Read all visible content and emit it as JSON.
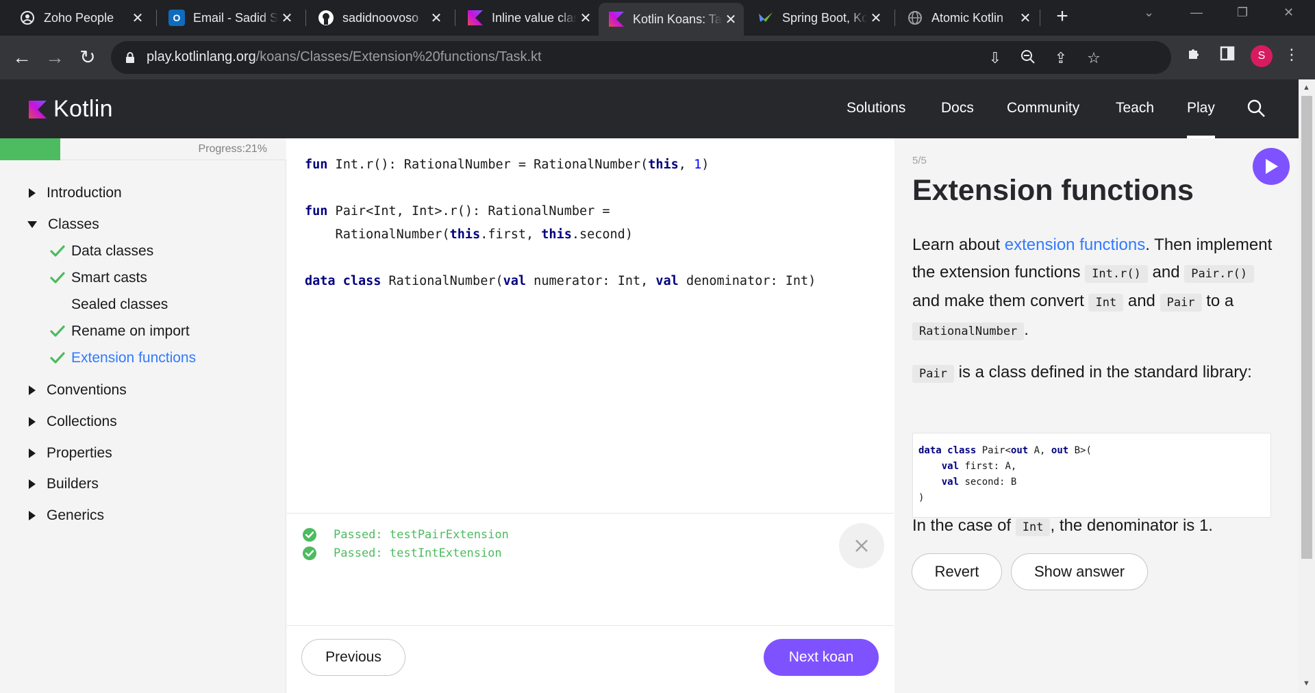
{
  "browser": {
    "tabs": [
      {
        "title": "Zoho People",
        "favicon_color": "#e8eaed"
      },
      {
        "title": "Email - Sadid Sahami",
        "favicon_color": "#0f6cbd"
      },
      {
        "title": "sadidnoovoso",
        "favicon_color": "#ffffff"
      },
      {
        "title": "Inline value classes",
        "favicon_color": "#7f52ff"
      },
      {
        "title": "Kotlin Koans: Task",
        "favicon_color": "#7f52ff"
      },
      {
        "title": "Spring Boot, Kotlin",
        "favicon_color": "#6db33f"
      },
      {
        "title": "Atomic Kotlin",
        "favicon_color": "#9aa0a6"
      }
    ],
    "active_tab_index": 4,
    "url_host": "play.kotlinlang.org",
    "url_path": "/koans/Classes/Extension%20functions/Task.kt",
    "profile_initial": "S"
  },
  "site": {
    "logo_text": "Kotlin",
    "nav": [
      "Solutions",
      "Docs",
      "Community",
      "Teach",
      "Play"
    ],
    "active_nav": "Play"
  },
  "sidebar": {
    "progress_label": "Progress:21%",
    "progress_fraction": 0.21,
    "sections": [
      {
        "label": "Introduction",
        "expanded": false
      },
      {
        "label": "Classes",
        "expanded": true,
        "items": [
          {
            "label": "Data classes",
            "completed": true,
            "current": false
          },
          {
            "label": "Smart casts",
            "completed": true,
            "current": false
          },
          {
            "label": "Sealed classes",
            "completed": false,
            "current": false
          },
          {
            "label": "Rename on import",
            "completed": true,
            "current": false
          },
          {
            "label": "Extension functions",
            "completed": true,
            "current": true
          }
        ]
      },
      {
        "label": "Conventions",
        "expanded": false
      },
      {
        "label": "Collections",
        "expanded": false
      },
      {
        "label": "Properties",
        "expanded": false
      },
      {
        "label": "Builders",
        "expanded": false
      },
      {
        "label": "Generics",
        "expanded": false
      }
    ]
  },
  "editor": {
    "lines": [
      "fun Int.r(): RationalNumber = RationalNumber(this, 1)",
      "",
      "fun Pair<Int, Int>.r(): RationalNumber =",
      "    RationalNumber(this.first, this.second)",
      "",
      "data class RationalNumber(val numerator: Int, val denominator: Int)"
    ]
  },
  "output": {
    "results": [
      {
        "text": "Passed: testPairExtension",
        "status": "passed"
      },
      {
        "text": "Passed: testIntExtension",
        "status": "passed"
      }
    ]
  },
  "footer": {
    "previous_label": "Previous",
    "next_label": "Next koan"
  },
  "task": {
    "counter": "5/5",
    "title": "Extension functions",
    "p1_before_link": "Learn about ",
    "p1_link": "extension functions",
    "p1_after_link": ". Then implement the extension functions ",
    "code_int_r": "Int.r()",
    "word_and_1": " and ",
    "code_pair_r": "Pair.r()",
    "p1_mid": " and make them convert ",
    "code_int": "Int",
    "word_and_2": " and ",
    "code_pair": "Pair",
    "p1_to_a": " to a ",
    "code_rational": "RationalNumber",
    "p1_end": ".",
    "p2_code": "Pair",
    "p2_text": " is a class defined in the standard library:",
    "snippet_lines": [
      "data class Pair<out A, out B>(",
      "    val first: A,",
      "    val second: B",
      ")"
    ],
    "p3_before": "In the case of ",
    "p3_code": "Int",
    "p3_after": ", the denominator is 1.",
    "revert_label": "Revert",
    "show_answer_label": "Show answer"
  },
  "colors": {
    "brand_purple": "#7f52ff",
    "pass_green": "#4dbb5f",
    "link_blue": "#307aff"
  }
}
